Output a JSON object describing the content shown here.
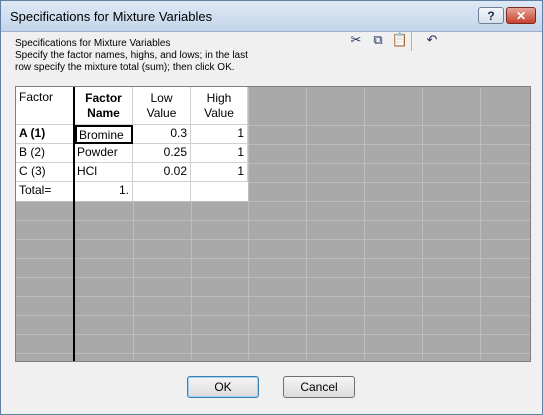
{
  "window": {
    "title": "Specifications for Mixture Variables"
  },
  "title_buttons": {
    "help": "?",
    "close": "✕"
  },
  "description": {
    "line1": "Specifications for Mixture Variables",
    "line2": "Specify the factor names, highs, and lows; in the last",
    "line3": "row specify the mixture total (sum); then click OK."
  },
  "toolbar": {
    "cut_glyph": "✂",
    "copy_glyph": "⧉",
    "paste_glyph": "📋",
    "undo_glyph": "↶"
  },
  "table": {
    "corner_label": "Factor",
    "columns": [
      {
        "line1": "Factor",
        "line2": "Name"
      },
      {
        "line1": "Low",
        "line2": "Value"
      },
      {
        "line1": "High",
        "line2": "Value"
      }
    ],
    "rows": [
      {
        "label": "A  (1)",
        "name": "Bromine",
        "low": "0.3",
        "high": "1"
      },
      {
        "label": "B  (2)",
        "name": "Powder",
        "low": "0.25",
        "high": "1"
      },
      {
        "label": "C  (3)",
        "name": "HCl",
        "low": "0.02",
        "high": "1"
      }
    ],
    "total": {
      "label": "Total=",
      "value": "1."
    }
  },
  "buttons": {
    "ok": "OK",
    "cancel": "Cancel"
  }
}
